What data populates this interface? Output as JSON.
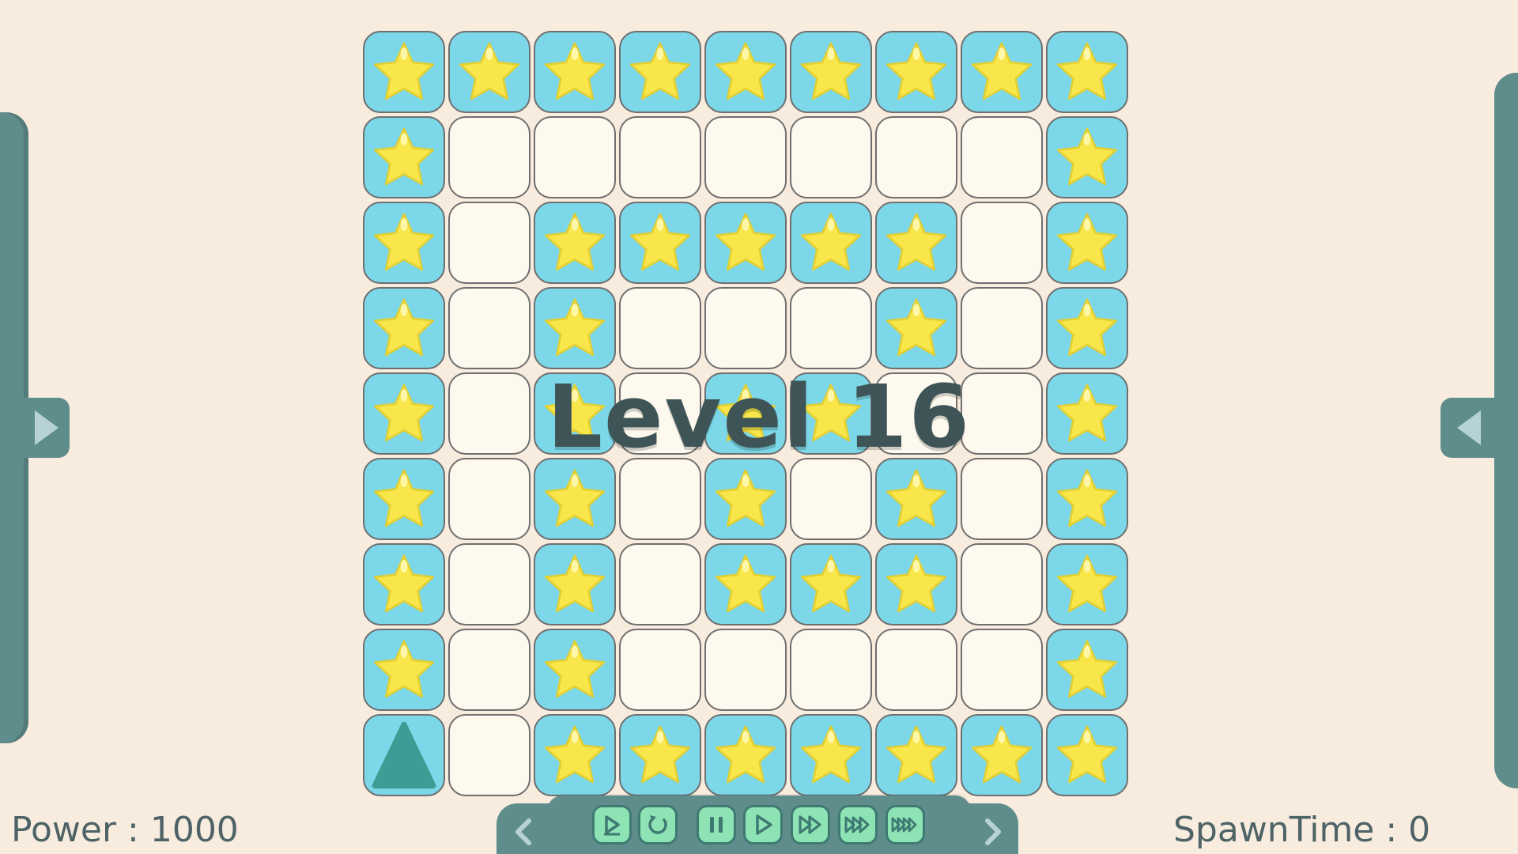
{
  "level": {
    "title": "Level 16"
  },
  "hud": {
    "power_text": "Power : 1000",
    "spawn_time_text": "SpawnTime : 0"
  },
  "colors": {
    "star_tile_bg": "#7cd8e8",
    "empty_tile_bg": "#fdf9ee",
    "star": "#f8e64a",
    "triangle": "#3f9c94",
    "panel": "#5f8d8b",
    "control_button": "#8ee3b4"
  },
  "board": {
    "rows": 9,
    "cols": 9,
    "legend": {
      "S": "star",
      "E": "empty",
      "T": "triangle"
    },
    "cells": [
      "SSSSSSSSS",
      "SEEEEEEES",
      "SESSSSSES",
      "SESEEESES",
      "SESESSEES",
      "SESESESES",
      "SESESSSES",
      "SESEEEEES",
      "TESSSSSSS"
    ]
  },
  "controls": {
    "buttons": [
      {
        "name": "step-play-button",
        "icon": "step-play-icon"
      },
      {
        "name": "restart-button",
        "icon": "restart-icon"
      },
      {
        "name": "pause-button",
        "icon": "pause-icon"
      },
      {
        "name": "play-button",
        "icon": "play-icon"
      },
      {
        "name": "fast-forward-button",
        "icon": "fast-forward-icon"
      },
      {
        "name": "faster-forward-button",
        "icon": "faster-forward-icon"
      },
      {
        "name": "fastest-forward-button",
        "icon": "fastest-forward-icon"
      }
    ],
    "prev_icon": "chevron-left-icon",
    "next_icon": "chevron-right-icon"
  }
}
